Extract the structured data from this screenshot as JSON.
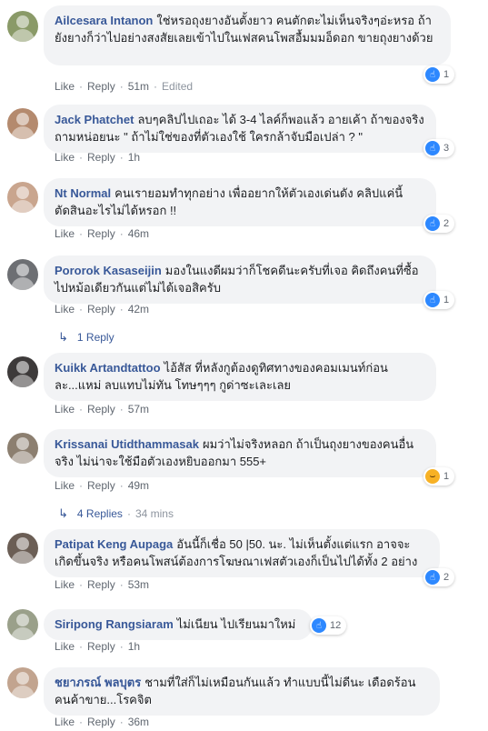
{
  "comments": [
    {
      "author": "Ailcesara Intanon",
      "text": "ใช่หรอถุงยางอันตั้งยาว คนตักตะไม่เห็นจริงๆอ่ะหรอ ถ้ายังยางก็ว่าไปอย่างสงสัยเลยเข้าไปในเฟสคนโพสอื้มมมอ็ดอก ขายถุงยางด้วย",
      "reaction": {
        "type": "like",
        "count": "1"
      },
      "like_label": "Like",
      "reply_label": "Reply",
      "time": "51m",
      "edited": "Edited",
      "avatar_color": "#8a9a68"
    },
    {
      "author": "Jack Phatchet",
      "text": "ลบๆคลิปไปเถอะ ได้ 3-4 ไลค์ก็พอแล้ว อายเค้า ถ้าของจริง ถามหน่อยนะ \" ถ้าไม่ใช่ของที่ตัวเองใช้ ใครกล้าจับมือเปล่า ? \"",
      "reaction": {
        "type": "like",
        "count": "3"
      },
      "like_label": "Like",
      "reply_label": "Reply",
      "time": "1h",
      "avatar_color": "#b48a6e"
    },
    {
      "author": "Nt Normal",
      "text": "คนเรายอมทำทุกอย่าง เพื่ออยากให้ตัวเองเด่นดัง คลิปแค่นี้ตัดสินอะไรไม่ได้หรอก !!",
      "reaction": {
        "type": "like",
        "count": "2"
      },
      "like_label": "Like",
      "reply_label": "Reply",
      "time": "46m",
      "avatar_color": "#c9a58e"
    },
    {
      "author": "Pororok Kasaseijin",
      "text": "มองในแงดีผมว่าก็โชคดีนะครับที่เจอ คิดถึงคนที่ซื้อไปหม้อเดียวกันแต่ไม่ได้เจอสิครับ",
      "reaction": {
        "type": "like",
        "count": "1"
      },
      "like_label": "Like",
      "reply_label": "Reply",
      "time": "42m",
      "avatar_color": "#6d6f73",
      "replies": {
        "label": "1 Reply"
      }
    },
    {
      "author": "Kuikk Artandtattoo",
      "text": "ไอ้สัส ที่หลังกูต้องดูทิศทางของคอมเมนท์ก่อนละ...แหม่ ลบแทบไม่ทัน โทษๆๆๆ กูด่าซะเละเลย",
      "like_label": "Like",
      "reply_label": "Reply",
      "time": "57m",
      "avatar_color": "#3d3a3a"
    },
    {
      "author": "Krissanai Utidthammasak",
      "text": "ผมว่าไม่จริงหลอก ถ้าเป็นถุงยางของคนอื่นจริง ไม่น่าจะใช้มือตัวเองหยิบออกมา 555+",
      "reaction": {
        "type": "haha",
        "count": "1"
      },
      "like_label": "Like",
      "reply_label": "Reply",
      "time": "49m",
      "avatar_color": "#8c7f70",
      "replies": {
        "label": "4 Replies",
        "time": "34 mins"
      }
    },
    {
      "author": "Patipat Keng Aupaga",
      "text": "อันนี้ก็เชื่อ 50 |50. นะ. ไม่เห็นตั้งแต่แรก อาจจะเกิดขึ้นจริง หรือคนโพสน์ต้องการโฆษณาเฟสตัวเองก็เป็นไปได้ทั้ง 2 อย่าง",
      "reaction": {
        "type": "like",
        "count": "2"
      },
      "like_label": "Like",
      "reply_label": "Reply",
      "time": "53m",
      "avatar_color": "#6b5e55"
    },
    {
      "author": "Siripong Rangsiaram",
      "text": "ไม่เนียน ไปเรียนมาใหม่",
      "reaction": {
        "type": "like",
        "count": "12"
      },
      "like_label": "Like",
      "reply_label": "Reply",
      "time": "1h",
      "avatar_color": "#9aa08a"
    },
    {
      "author": "ชยาภรณ์ พลบุตร",
      "text": "ชามที่ใส่ก็ไม่เหมือนกันแล้ว ทำแบบนี้ไม่ดีนะ เดือดร้อนคนค้าขาย...โรคจิต",
      "like_label": "Like",
      "reply_label": "Reply",
      "time": "36m",
      "avatar_color": "#c2a48f"
    }
  ]
}
